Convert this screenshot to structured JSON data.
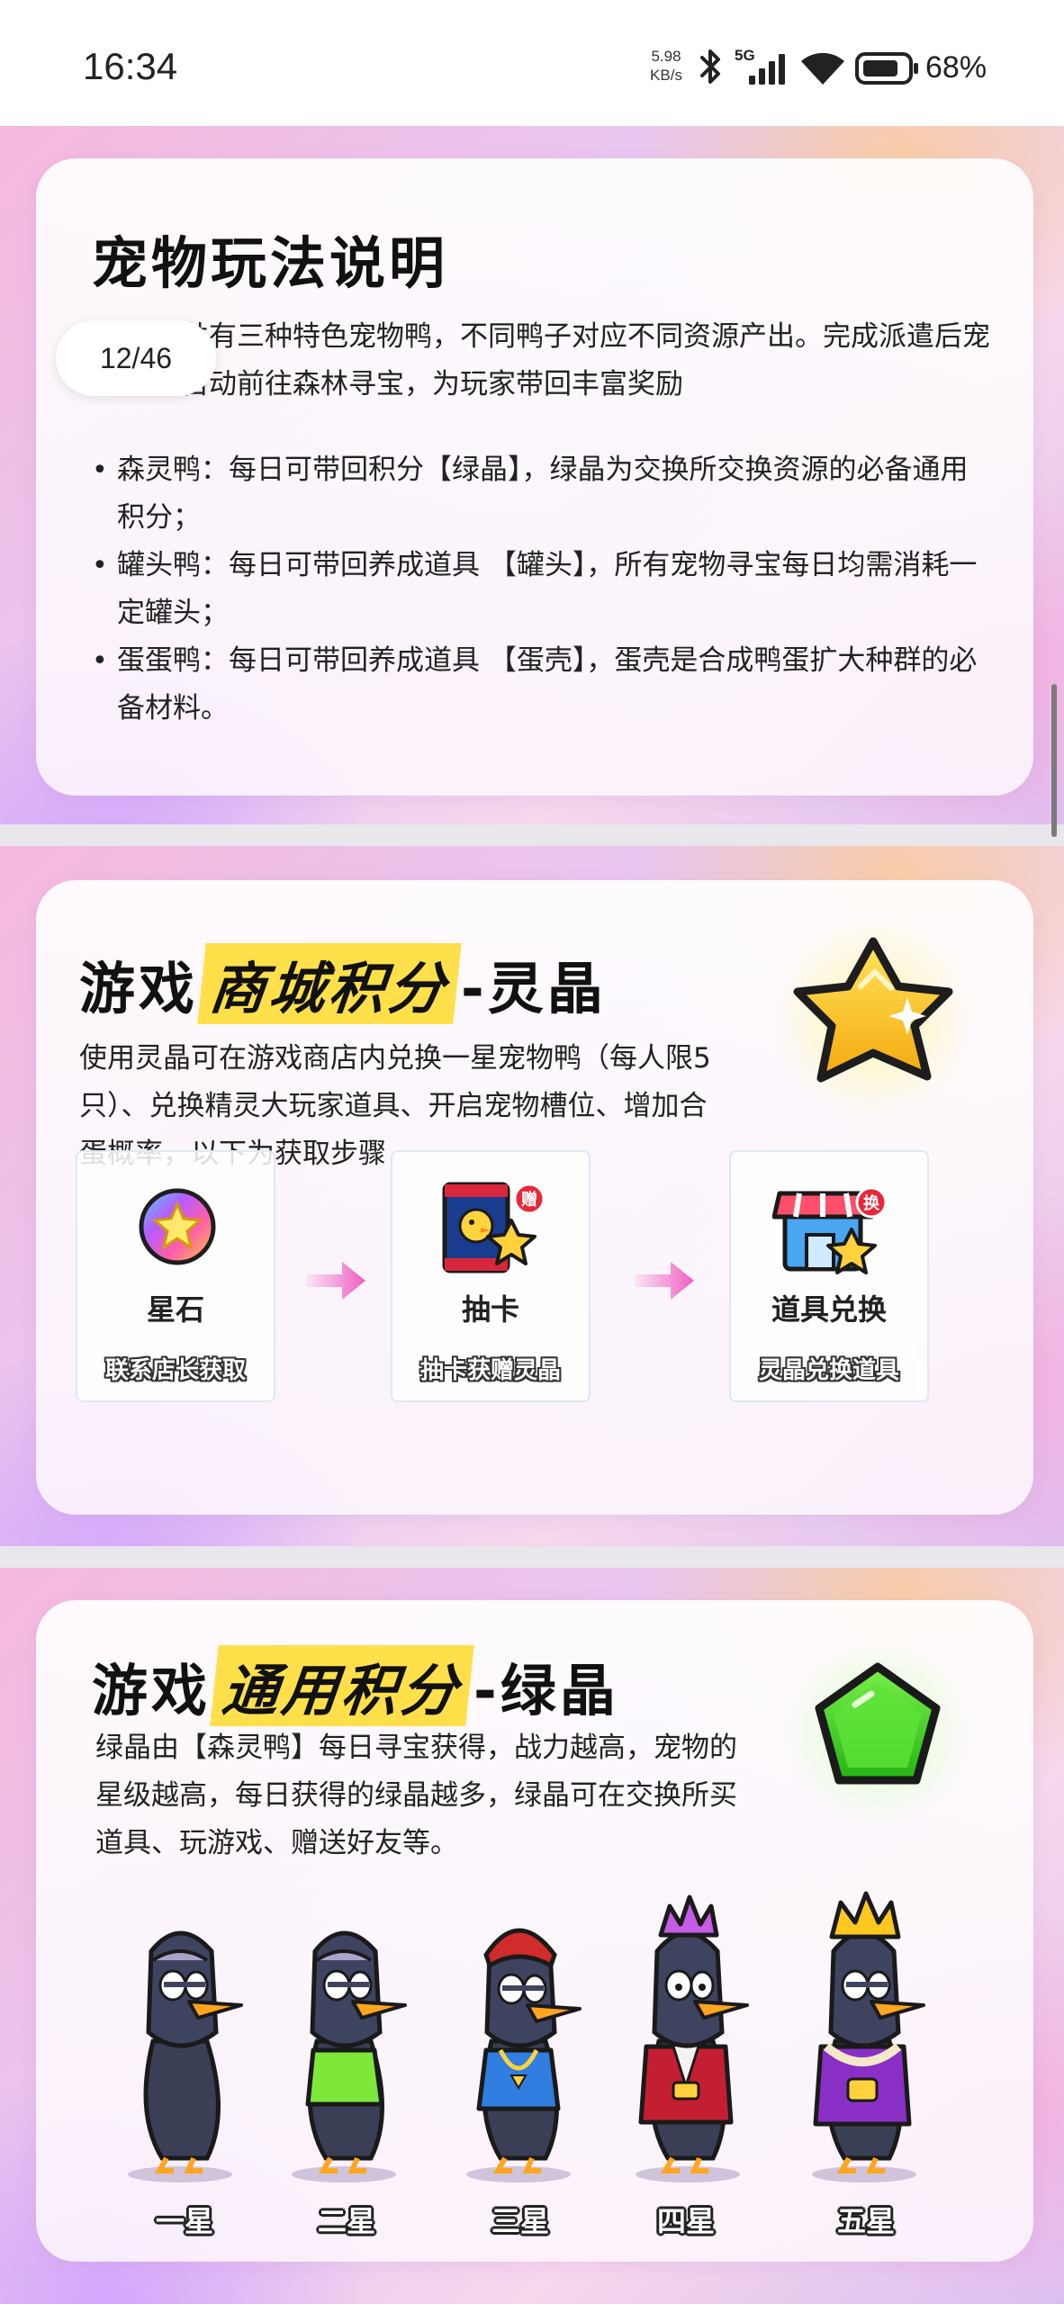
{
  "status_bar": {
    "time": "16:34",
    "net_speed_value": "5.98",
    "net_speed_unit": "KB/s",
    "network_label": "5G",
    "battery": "68%",
    "icons": [
      "bluetooth-icon",
      "signal-icon",
      "wifi-icon",
      "battery-icon"
    ]
  },
  "page_indicator": "12/46",
  "section1": {
    "title": "宠物玩法说明",
    "intro": "游戏内共有三种特色宠物鸭，不同鸭子对应不同资源产出。完成派遣后宠物鸭将自动前往森林寻宝，为玩家带回丰富奖励",
    "bullets": [
      "森灵鸭：每日可带回积分【绿晶】，绿晶为交换所交换资源的必备通用积分；",
      "罐头鸭：每日可带回养成道具 【罐头】，所有宠物寻宝每日均需消耗一定罐头；",
      "蛋蛋鸭：每日可带回养成道具 【蛋壳】，蛋壳是合成鸭蛋扩大种群的必备材料。"
    ]
  },
  "section2": {
    "title_pre": "游戏",
    "title_hl": "商城积分",
    "title_post": "-灵晶",
    "desc": "使用灵晶可在游戏商店内兑换一星宠物鸭（每人限5只）、兑换精灵大玩家道具、开启宠物槽位、增加合蛋概率，以下为获取步骤",
    "steps": [
      {
        "name": "星石",
        "sub": "联系店长获取",
        "icon": "star-stone-icon"
      },
      {
        "name": "抽卡",
        "sub": "抽卡获赠灵晶",
        "icon": "card-pack-icon",
        "badge": "赠"
      },
      {
        "name": "道具兑换",
        "sub": "灵晶兑换道具",
        "icon": "shop-icon",
        "badge": "换"
      }
    ]
  },
  "section3": {
    "title_pre": "游戏",
    "title_hl": "通用积分",
    "title_post": "-绿晶",
    "desc": "绿晶由【森灵鸭】每日寻宝获得，战力越高，宠物的星级越高，每日获得的绿晶越多，绿晶可在交换所买道具、玩游戏、赠送好友等。",
    "ducks": [
      "一星",
      "二星",
      "三星",
      "四星",
      "五星"
    ]
  },
  "colors": {
    "highlight": "#ffe04a",
    "arrow": "#ee5fc0",
    "green_gem": "#3ccc1e",
    "gold_star": "#ffc81e"
  }
}
